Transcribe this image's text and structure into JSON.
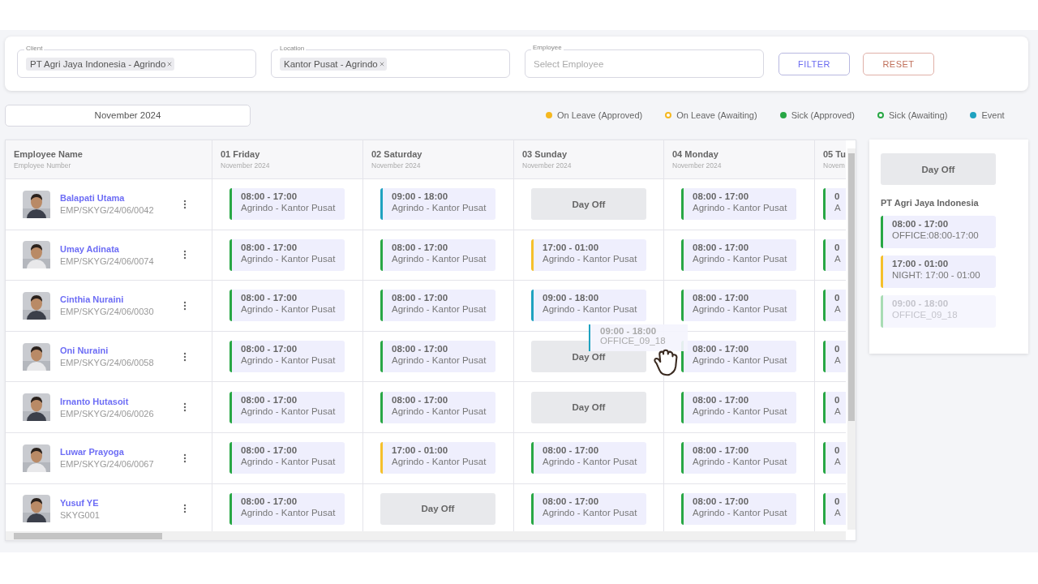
{
  "filters": {
    "client": {
      "label": "Client",
      "tags": [
        "PT Agri Jaya Indonesia - Agrindo"
      ]
    },
    "location": {
      "label": "Location",
      "tags": [
        "Kantor Pusat - Agrindo"
      ]
    },
    "employee": {
      "label": "Employee",
      "placeholder": "Select Employee"
    }
  },
  "buttons": [
    {
      "label": "FILTER",
      "kind": "filter"
    },
    {
      "label": "RESET",
      "kind": "reset"
    }
  ],
  "month": "November 2024",
  "legend": [
    {
      "label": "On Leave (Approved)",
      "color": "#f5b820",
      "kind": "solid"
    },
    {
      "label": "On Leave (Awaiting)",
      "color": "#f5b820",
      "kind": "ring"
    },
    {
      "label": "Sick (Approved)",
      "color": "#28a745",
      "kind": "solid"
    },
    {
      "label": "Sick (Awaiting)",
      "color": "#28a745",
      "kind": "ring"
    },
    {
      "label": "Event",
      "color": "#1fa2c0",
      "kind": "solid"
    }
  ],
  "table": {
    "columns": [
      {
        "title": "Employee Name",
        "subtitle": "Employee Number"
      },
      {
        "title": "01 Friday",
        "subtitle": "November 2024"
      },
      {
        "title": "02 Saturday",
        "subtitle": "November 2024"
      },
      {
        "title": "03 Sunday",
        "subtitle": "November 2024"
      },
      {
        "title": "04 Monday",
        "subtitle": "November 2024"
      },
      {
        "title": "05 Tu",
        "subtitle": "Novem"
      }
    ],
    "rows": [
      {
        "name": "Balapati Utama",
        "number": "EMP/SKYG/24/06/0042",
        "cells": [
          {
            "kind": "shift",
            "time": "08:00 - 17:00",
            "location": "Agrindo - Kantor Pusat",
            "color": "#28a745"
          },
          {
            "kind": "shift",
            "time": "09:00 - 18:00",
            "location": "Agrindo - Kantor Pusat",
            "color": "#1fa2c0"
          },
          {
            "kind": "day_off",
            "label": "Day Off"
          },
          {
            "kind": "shift",
            "time": "08:00 - 17:00",
            "location": "Agrindo - Kantor Pusat",
            "color": "#28a745"
          },
          {
            "kind": "shift",
            "time": "0",
            "location": "A",
            "color": "#28a745"
          }
        ]
      },
      {
        "name": "Umay Adinata",
        "number": "EMP/SKYG/24/06/0074",
        "cells": [
          {
            "kind": "shift",
            "time": "08:00 - 17:00",
            "location": "Agrindo - Kantor Pusat",
            "color": "#28a745"
          },
          {
            "kind": "shift",
            "time": "08:00 - 17:00",
            "location": "Agrindo - Kantor Pusat",
            "color": "#28a745"
          },
          {
            "kind": "shift",
            "time": "17:00 - 01:00",
            "location": "Agrindo - Kantor Pusat",
            "color": "#f5c02b"
          },
          {
            "kind": "shift",
            "time": "08:00 - 17:00",
            "location": "Agrindo - Kantor Pusat",
            "color": "#28a745"
          },
          {
            "kind": "shift",
            "time": "0",
            "location": "A",
            "color": "#28a745"
          }
        ]
      },
      {
        "name": "Cinthia Nuraini",
        "number": "EMP/SKYG/24/06/0030",
        "cells": [
          {
            "kind": "shift",
            "time": "08:00 - 17:00",
            "location": "Agrindo - Kantor Pusat",
            "color": "#28a745"
          },
          {
            "kind": "shift",
            "time": "08:00 - 17:00",
            "location": "Agrindo - Kantor Pusat",
            "color": "#28a745"
          },
          {
            "kind": "shift",
            "time": "09:00 - 18:00",
            "location": "Agrindo - Kantor Pusat",
            "color": "#1fa2c0"
          },
          {
            "kind": "shift",
            "time": "08:00 - 17:00",
            "location": "Agrindo - Kantor Pusat",
            "color": "#28a745"
          },
          {
            "kind": "shift",
            "time": "0",
            "location": "A",
            "color": "#28a745"
          }
        ]
      },
      {
        "name": "Oni Nuraini",
        "number": "EMP/SKYG/24/06/0058",
        "cells": [
          {
            "kind": "shift",
            "time": "08:00 - 17:00",
            "location": "Agrindo - Kantor Pusat",
            "color": "#28a745"
          },
          {
            "kind": "shift",
            "time": "08:00 - 17:00",
            "location": "Agrindo - Kantor Pusat",
            "color": "#28a745"
          },
          {
            "kind": "day_off",
            "label": "Day Off"
          },
          {
            "kind": "shift",
            "time": "08:00 - 17:00",
            "location": "Agrindo - Kantor Pusat",
            "color": "#28a745"
          },
          {
            "kind": "shift",
            "time": "0",
            "location": "A",
            "color": "#28a745"
          }
        ]
      },
      {
        "name": "Irnanto Hutasoit",
        "number": "EMP/SKYG/24/06/0026",
        "cells": [
          {
            "kind": "shift",
            "time": "08:00 - 17:00",
            "location": "Agrindo - Kantor Pusat",
            "color": "#28a745"
          },
          {
            "kind": "shift",
            "time": "08:00 - 17:00",
            "location": "Agrindo - Kantor Pusat",
            "color": "#28a745"
          },
          {
            "kind": "day_off",
            "label": "Day Off"
          },
          {
            "kind": "shift",
            "time": "08:00 - 17:00",
            "location": "Agrindo - Kantor Pusat",
            "color": "#28a745"
          },
          {
            "kind": "shift",
            "time": "0",
            "location": "A",
            "color": "#28a745"
          }
        ]
      },
      {
        "name": "Luwar Prayoga",
        "number": "EMP/SKYG/24/06/0067",
        "cells": [
          {
            "kind": "shift",
            "time": "08:00 - 17:00",
            "location": "Agrindo - Kantor Pusat",
            "color": "#28a745"
          },
          {
            "kind": "shift",
            "time": "17:00 - 01:00",
            "location": "Agrindo - Kantor Pusat",
            "color": "#f5c02b"
          },
          {
            "kind": "shift",
            "time": "08:00 - 17:00",
            "location": "Agrindo - Kantor Pusat",
            "color": "#28a745"
          },
          {
            "kind": "shift",
            "time": "08:00 - 17:00",
            "location": "Agrindo - Kantor Pusat",
            "color": "#28a745"
          },
          {
            "kind": "shift",
            "time": "0",
            "location": "A",
            "color": "#28a745"
          }
        ]
      },
      {
        "name": "Yusuf YE",
        "number": "SKYG001",
        "cells": [
          {
            "kind": "shift",
            "time": "08:00 - 17:00",
            "location": "Agrindo - Kantor Pusat",
            "color": "#28a745"
          },
          {
            "kind": "day_off",
            "label": "Day Off"
          },
          {
            "kind": "shift",
            "time": "08:00 - 17:00",
            "location": "Agrindo - Kantor Pusat",
            "color": "#28a745"
          },
          {
            "kind": "shift",
            "time": "08:00 - 17:00",
            "location": "Agrindo - Kantor Pusat",
            "color": "#28a745"
          },
          {
            "kind": "shift",
            "time": "0",
            "location": "A",
            "color": "#28a745"
          }
        ]
      }
    ]
  },
  "drag_preview": {
    "time": "09:00 - 18:00",
    "label": "OFFICE_09_18",
    "color": "#1fa2c0"
  },
  "panel": {
    "day_off": "Day Off",
    "client": "PT Agri Jaya Indonesia",
    "templates": [
      {
        "time": "08:00 - 17:00",
        "label": "OFFICE:08:00-17:00",
        "color": "#28a745",
        "dragging": false
      },
      {
        "time": "17:00 - 01:00",
        "label": "NIGHT: 17:00 - 01:00",
        "color": "#f5c02b",
        "dragging": false
      },
      {
        "time": "09:00 - 18:00",
        "label": "OFFICE_09_18",
        "color": "#a8dcb4",
        "dragging": true
      }
    ]
  }
}
